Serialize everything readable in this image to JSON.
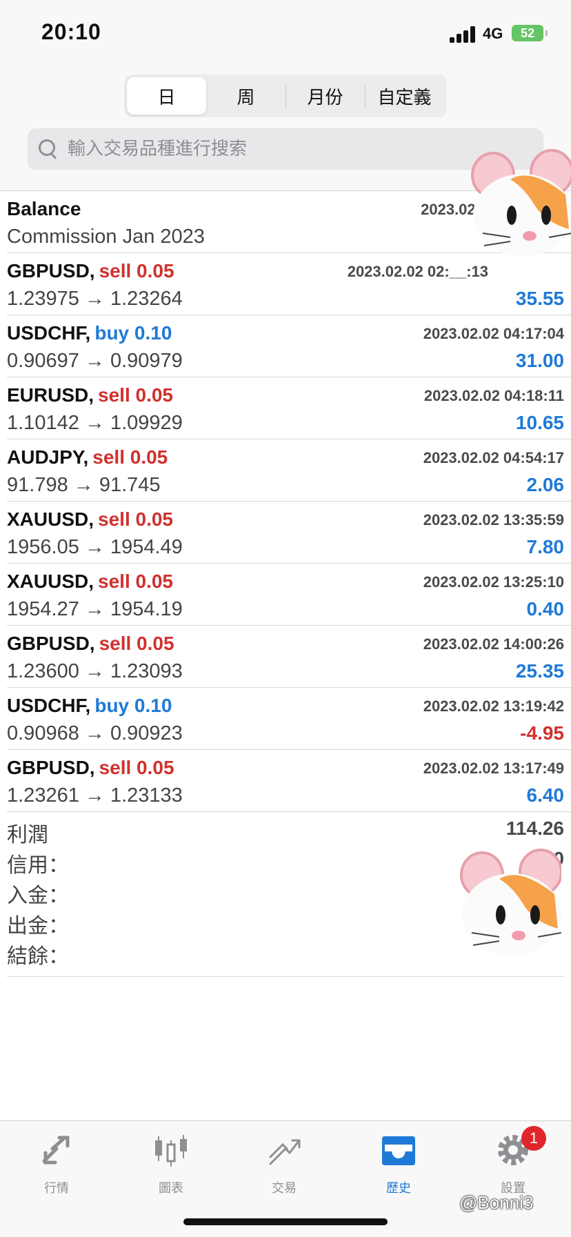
{
  "status": {
    "time": "20:10",
    "network": "4G",
    "battery": "52"
  },
  "segments": [
    "日",
    "周",
    "月份",
    "自定義"
  ],
  "search": {
    "placeholder": "輸入交易品種進行搜索"
  },
  "balance": {
    "title": "Balance",
    "comment": "Commission Jan 2023",
    "timestamp": "2023.02.0"
  },
  "trades": [
    {
      "symbol": "GBPUSD,",
      "side": "sell 0.05",
      "time": "2023.02.02 02:__:13",
      "prices": "1.23975 → 1.23264",
      "profit": "35.55"
    },
    {
      "symbol": "USDCHF,",
      "side": "buy 0.10",
      "time": "2023.02.02 04:17:04",
      "prices": "0.90697 → 0.90979",
      "profit": "31.00"
    },
    {
      "symbol": "EURUSD,",
      "side": "sell 0.05",
      "time": "2023.02.02 04:18:11",
      "prices": "1.10142 → 1.09929",
      "profit": "10.65"
    },
    {
      "symbol": "AUDJPY,",
      "side": "sell 0.05",
      "time": "2023.02.02 04:54:17",
      "prices": "91.798 → 91.745",
      "profit": "2.06"
    },
    {
      "symbol": "XAUUSD,",
      "side": "sell 0.05",
      "time": "2023.02.02 13:35:59",
      "prices": "1956.05 → 1954.49",
      "profit": "7.80"
    },
    {
      "symbol": "XAUUSD,",
      "side": "sell 0.05",
      "time": "2023.02.02 13:25:10",
      "prices": "1954.27 → 1954.19",
      "profit": "0.40"
    },
    {
      "symbol": "GBPUSD,",
      "side": "sell 0.05",
      "time": "2023.02.02 14:00:26",
      "prices": "1.23600 → 1.23093",
      "profit": "25.35"
    },
    {
      "symbol": "USDCHF,",
      "side": "buy 0.10",
      "time": "2023.02.02 13:19:42",
      "prices": "0.90968 → 0.90923",
      "profit": "-4.95"
    },
    {
      "symbol": "GBPUSD,",
      "side": "sell 0.05",
      "time": "2023.02.02 13:17:49",
      "prices": "1.23261 → 1.23133",
      "profit": "6.40"
    }
  ],
  "summary": [
    {
      "label": "利潤",
      "value": "114.26"
    },
    {
      "label": "信用：",
      "value": "0"
    },
    {
      "label": "入金：",
      "value": ""
    },
    {
      "label": "出金：",
      "value": ""
    },
    {
      "label": "結餘：",
      "value": ""
    }
  ],
  "tabs": [
    "行情",
    "圖表",
    "交易",
    "歷史",
    "設置"
  ],
  "settings_badge": "1",
  "watermark": "@Bonni3",
  "colors": {
    "sell": "#d0312d",
    "buy": "#1f7ad7",
    "profit_pos": "#1f7ad7",
    "profit_neg": "#d0312d",
    "active_tab": "#1f7ad7"
  }
}
